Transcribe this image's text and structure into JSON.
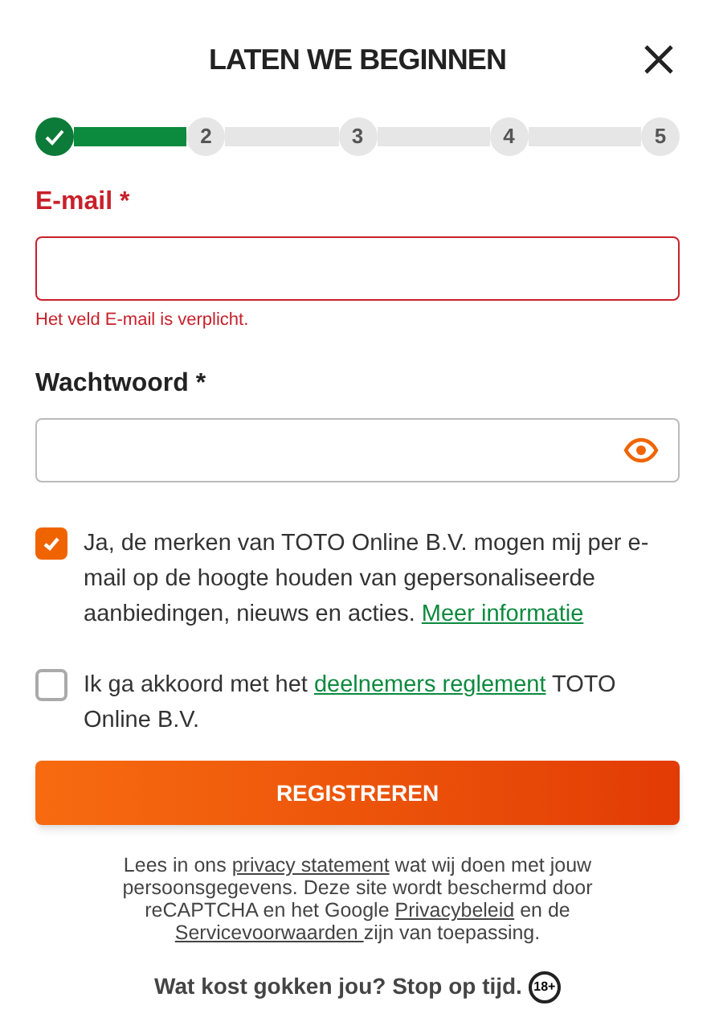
{
  "title": "LATEN WE BEGINNEN",
  "steps": [
    {
      "completed": true
    },
    {
      "label": "2",
      "completed": false
    },
    {
      "label": "3",
      "completed": false
    },
    {
      "label": "4",
      "completed": false
    },
    {
      "label": "5",
      "completed": false
    }
  ],
  "fields": [
    {
      "label": "E-mail *",
      "error": "Het veld E-mail is verplicht.",
      "invalid": true,
      "kind": "text"
    },
    {
      "label": "Wachtwoord *",
      "invalid": false,
      "kind": "password"
    }
  ],
  "consents": [
    {
      "checked": true,
      "before": "Ja, de merken van TOTO Online B.V. mogen mij per e-mail op de hoogte houden van gepersonaliseerde aanbiedingen, nieuws en acties.",
      "link": "Meer informatie"
    },
    {
      "checked": false,
      "before": "Ik ga akkoord met het",
      "link": "deelnemers reglement",
      "after": "TOTO Online B.V."
    }
  ],
  "submit": "REGISTREREN",
  "privacy": [
    {
      "text": "Lees in ons "
    },
    {
      "text": "privacy statement",
      "link": true
    },
    {
      "text": " wat wij doen met jouw persoonsgegevens. Deze site wordt beschermd door reCAPTCHA en het Google "
    },
    {
      "text": "Privacybeleid",
      "link": true
    },
    {
      "text": " en de "
    },
    {
      "text": "Servicevoorwaarden ",
      "link": true
    },
    {
      "text": "zijn van toepassing."
    }
  ],
  "footer": {
    "text": "Wat kost gokken jou? Stop op tijd.",
    "badge": "18+"
  }
}
